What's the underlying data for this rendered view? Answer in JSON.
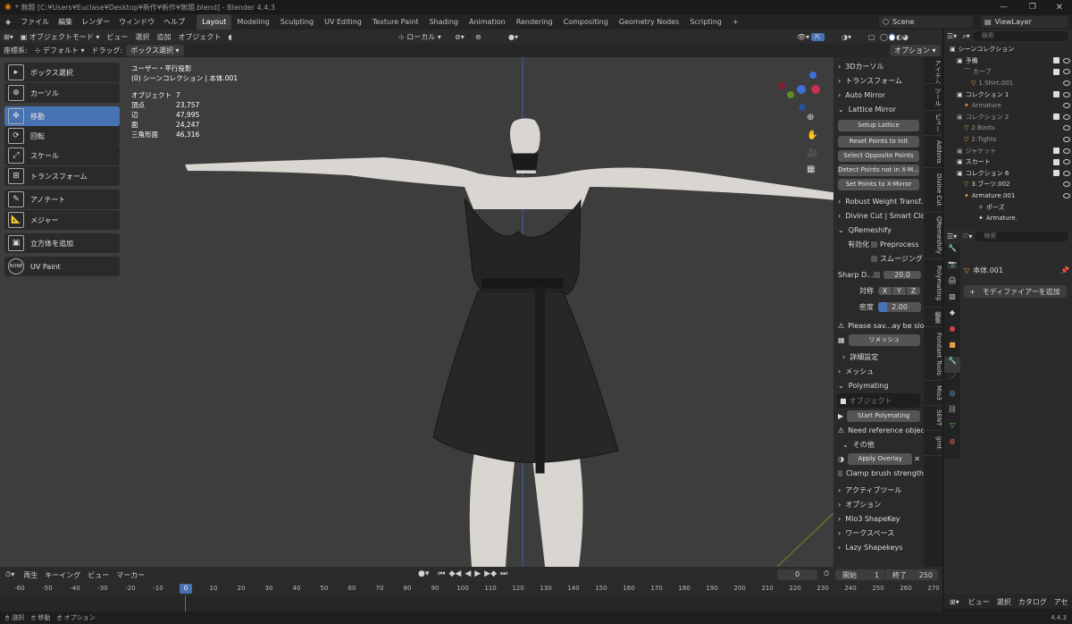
{
  "title": "* 無題 [C:¥Users¥Euclase¥Desktop¥新作¥新作¥無題.blend] - Blender 4.4.3",
  "menus": [
    "ファイル",
    "編集",
    "レンダー",
    "ウィンドウ",
    "ヘルプ"
  ],
  "workspaces": [
    "Layout",
    "Modeling",
    "Sculpting",
    "UV Editing",
    "Texture Paint",
    "Shading",
    "Animation",
    "Rendering",
    "Compositing",
    "Geometry Nodes",
    "Scripting"
  ],
  "scene": "Scene",
  "view_layer": "ViewLayer",
  "header": {
    "mode": "オブジェクトモード",
    "menus": [
      "ビュー",
      "選択",
      "追加",
      "オブジェクト"
    ],
    "transform_space": "ローカル",
    "options": "オプション"
  },
  "header2": {
    "coord_label": "座標系:",
    "coord_value": "デフォルト",
    "drag_label": "ドラッグ:",
    "drag_value": "ボックス選択"
  },
  "tools": [
    "ボックス選択",
    "カーソル",
    "移動",
    "回転",
    "スケール",
    "トランスフォーム",
    "アノテート",
    "メジャー",
    "立方体を追加",
    "UV Paint"
  ],
  "overlay": {
    "projection": "ユーザー・平行投影",
    "collection": "(0) シーンコレクション | 本体.001",
    "stats": [
      {
        "label": "オブジェクト",
        "value": "7"
      },
      {
        "label": "頂点",
        "value": "23,757"
      },
      {
        "label": "辺",
        "value": "47,995"
      },
      {
        "label": "面",
        "value": "24,247"
      },
      {
        "label": "三角形面",
        "value": "46,316"
      }
    ]
  },
  "npanel": {
    "cursor3d": "3Dカーソル",
    "transform": "トランスフォーム",
    "auto_mirror": "Auto Mirror",
    "lattice_mirror": "Lattice Mirror",
    "setup_lattice": "Setup Lattice",
    "reset_points": "Reset Points to Init",
    "select_opposite": "Select Opposite Points",
    "detect_points": "Detect Points not in X-M...",
    "set_points": "Set Points to X-Mirror",
    "robust": "Robust Weight Transf...",
    "divine": "Divine Cut | Smart Cloth Con...",
    "qremeshify": "QRemeshify",
    "enable": "有効化",
    "preprocess": "Preprocess",
    "smoothing": "スムージング",
    "sharp_label": "Sharp D...",
    "sharp_value": "20.0",
    "sym_label": "対称",
    "sym": [
      "X",
      "Y",
      "Z"
    ],
    "density_label": "密度",
    "density_value": "2.00",
    "warning": "Please sav...ay be slow",
    "remesh": "リメッシュ",
    "advanced": "詳細設定",
    "mesh": "メッシュ",
    "polymating": "Polymating",
    "object_placeholder": "オブジェクト",
    "start_polymating": "Start Polymating",
    "need_ref": "Need reference object",
    "other": "その他",
    "apply_overlay": "Apply Overlay",
    "clamp_brush": "Clamp brush strength",
    "active_tool": "アクティブツール",
    "options": "オプション",
    "mio3_shapekey": "Mio3 ShapeKey",
    "workspace": "ワークスペース",
    "lazy_shapekeys": "Lazy Shapekeys"
  },
  "vtabs": [
    "アイテム",
    "ツール",
    "ビュー",
    "Addons",
    "Divine Cut",
    "QRemeshify",
    "Polymating",
    "編集",
    "Fondant Tools",
    "Mio3",
    "SENT",
    "grnt"
  ],
  "outliner": {
    "search": "検索",
    "root": "シーンコレクション",
    "items": [
      "予備",
      "カーブ",
      "1.Shirt.001",
      "コレクション 1",
      "Armature",
      "コレクション 2",
      "2.Boots",
      "2.Tights",
      "ジャケット",
      "スカート",
      "コレクション 6",
      "3.ブーツ.002",
      "Armature.001",
      "ポーズ",
      "Armature."
    ]
  },
  "properties": {
    "search": "検索",
    "object": "本体.001",
    "add_modifier": "モディファイアーを追加"
  },
  "timeline": {
    "menus": [
      "再生",
      "キーイング",
      "ビュー",
      "マーカー"
    ],
    "current_frame": "0",
    "start_label": "開始",
    "start": "1",
    "end_label": "終了",
    "end": "250",
    "ruler": [
      "-60",
      "-50",
      "-40",
      "-30",
      "-20",
      "-10",
      "0",
      "10",
      "20",
      "30",
      "40",
      "50",
      "60",
      "70",
      "80",
      "90",
      "100",
      "110",
      "120",
      "130",
      "140",
      "150",
      "160",
      "170",
      "180",
      "190",
      "200",
      "210",
      "220",
      "230",
      "240",
      "250",
      "260",
      "270"
    ]
  },
  "status": {
    "select": "選択",
    "move": "移動",
    "options": "オプション",
    "version": "4.4.3"
  },
  "bottom_right": {
    "menus": [
      "ビュー",
      "選択",
      "カタログ",
      "アセ"
    ]
  },
  "colors": {
    "accent": "#4772b3",
    "viewport_bg": "#3d3d3d",
    "garment": "#1e2020"
  }
}
